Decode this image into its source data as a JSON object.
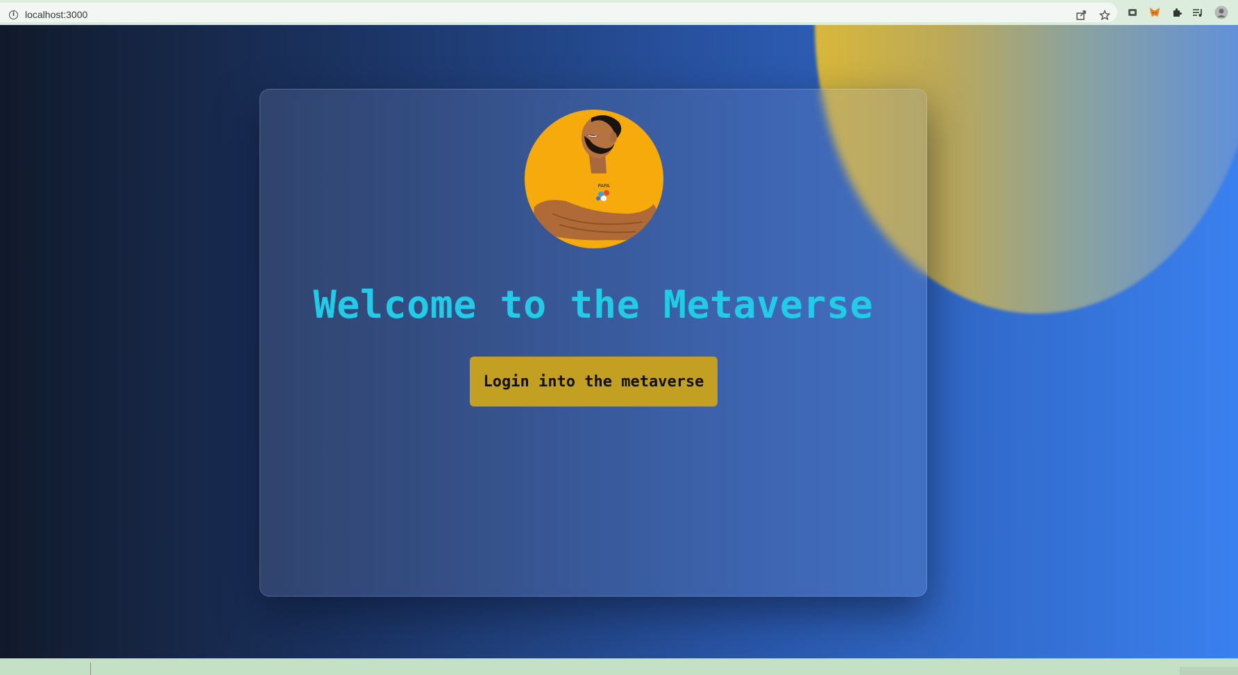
{
  "browser": {
    "url": "localhost:3000",
    "info_symbol": "i",
    "toolbar_icons": [
      "share-icon",
      "star-icon",
      "extension-app-icon",
      "metamask-fox-icon",
      "puzzle-extensions-icon",
      "reading-list-icon",
      "profile-avatar-icon"
    ]
  },
  "page": {
    "title": "Welcome to the Metaverse",
    "login_button": "Login into the metaverse",
    "avatar_shirt_text": "PAPA"
  },
  "colors": {
    "title": "#22cbe8",
    "button": "#c39f22",
    "avatar_bg": "#f6aa0c"
  }
}
